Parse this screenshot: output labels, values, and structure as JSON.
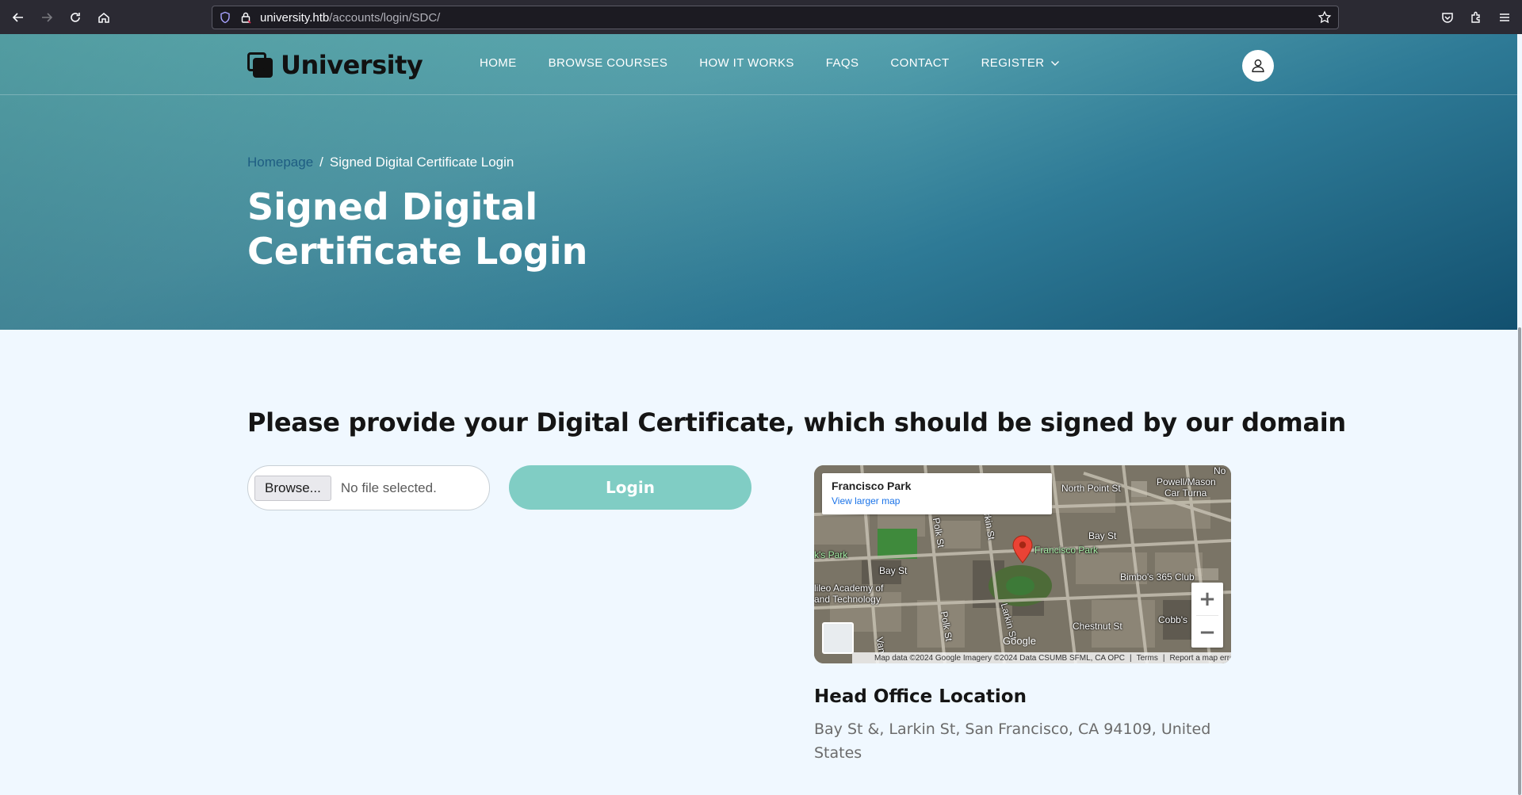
{
  "browser": {
    "url_host": "university.htb",
    "url_path": "/accounts/login/SDC/"
  },
  "nav": {
    "logo_text": "University",
    "items": [
      {
        "label": "HOME"
      },
      {
        "label": "BROWSE COURSES"
      },
      {
        "label": "HOW IT WORKS"
      },
      {
        "label": "FAQS"
      },
      {
        "label": "CONTACT"
      },
      {
        "label": "REGISTER"
      }
    ]
  },
  "hero": {
    "breadcrumb_home": "Homepage",
    "breadcrumb_sep": "/",
    "breadcrumb_current": "Signed Digital Certificate Login",
    "title": "Signed Digital Certificate Login"
  },
  "form": {
    "heading": "Please provide your Digital Certificate, which should be signed by our domain",
    "browse_label": "Browse...",
    "file_status": "No file selected.",
    "login_label": "Login"
  },
  "map": {
    "place_title": "Francisco Park",
    "view_larger": "View larger map",
    "labels": {
      "north_point": "North Point St",
      "powell": "Powell/Mason",
      "car_turn": "Car Turna",
      "bay_st_right": "Bay St",
      "bay_st_left": "Bay St",
      "francisco_park": "Francisco Park",
      "ks_park": "k's Park",
      "galileo_1": "lileo Academy of",
      "galileo_2": "and Technology",
      "bimbo": "Bimbo's 365 Club",
      "cobbs": "Cobb's",
      "chestnut": "Chestnut St",
      "polk_1": "Polk St",
      "polk_2": "Polk St",
      "larkin_1": "rkin St",
      "larkin_2": "Larkin St",
      "van": "Van",
      "ne": "No"
    },
    "google": "Google",
    "footer_data": "Map data ©2024 Google Imagery ©2024 Data CSUMB SFML, CA OPC",
    "footer_terms": "Terms",
    "footer_report": "Report a map error",
    "zoom_in": "+",
    "zoom_out": "−"
  },
  "office": {
    "title": "Head Office Location",
    "address": "Bay St &, Larkin St, San Francisco, CA 94109, United States"
  },
  "icons": {
    "back": "arrow-left-icon",
    "forward": "arrow-right-icon",
    "reload": "reload-icon",
    "home": "home-icon",
    "shield": "shield-icon",
    "lock": "lock-icon",
    "star": "star-icon",
    "pocket": "pocket-icon",
    "extensions": "extensions-icon",
    "menu": "hamburger-menu-icon",
    "user": "user-icon"
  },
  "colors": {
    "login_button": "#80cdc4",
    "breadcrumb_link": "#1e5d82",
    "page_bg": "#f0f8ff"
  }
}
